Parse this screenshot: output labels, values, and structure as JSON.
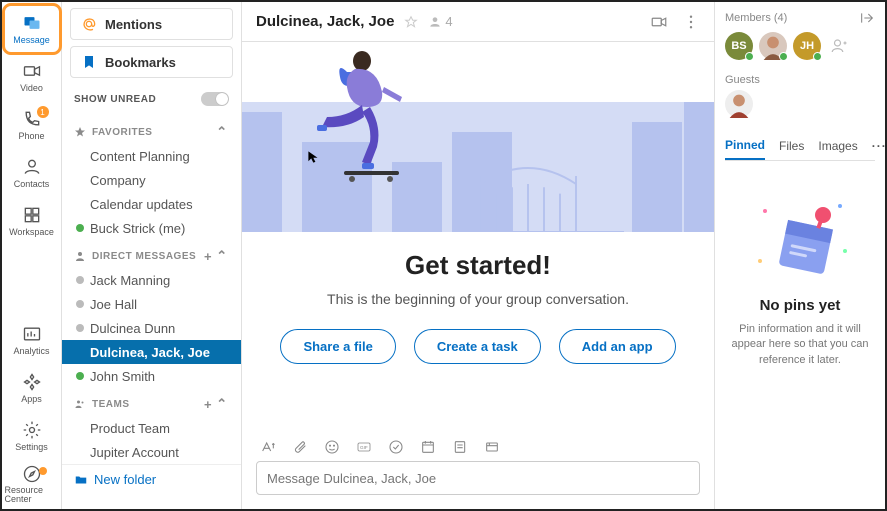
{
  "rail": {
    "items": [
      {
        "label": "Message",
        "active": true
      },
      {
        "label": "Video"
      },
      {
        "label": "Phone",
        "badge": "1"
      },
      {
        "label": "Contacts"
      },
      {
        "label": "Workspace"
      }
    ],
    "bottom": [
      {
        "label": "Analytics"
      },
      {
        "label": "Apps"
      },
      {
        "label": "Settings"
      },
      {
        "label": "Resource Center",
        "dot": true
      }
    ]
  },
  "sidebar": {
    "tabs": [
      {
        "label": "Mentions"
      },
      {
        "label": "Bookmarks"
      }
    ],
    "show_unread": "SHOW UNREAD",
    "sections": {
      "favorites": {
        "title": "FAVORITES",
        "items": [
          "Content Planning",
          "Company",
          "Calendar updates",
          "Buck Strick (me)"
        ]
      },
      "direct": {
        "title": "DIRECT MESSAGES",
        "items": [
          "Jack Manning",
          "Joe Hall",
          "Dulcinea Dunn",
          "Dulcinea, Jack, Joe",
          "John Smith"
        ]
      },
      "teams": {
        "title": "TEAMS",
        "items": [
          "Product Team",
          "Jupiter Account"
        ]
      }
    },
    "new_folder": "New folder"
  },
  "conversation": {
    "title": "Dulcinea, Jack, Joe",
    "member_count": "4",
    "get_started": "Get started!",
    "subtitle": "This is the beginning of your group conversation.",
    "actions": [
      "Share a file",
      "Create a task",
      "Add an app"
    ],
    "composer_placeholder": "Message Dulcinea, Jack, Joe"
  },
  "members": {
    "title": "Members (4)",
    "avatars": [
      {
        "initials": "BS",
        "bg": "#7a8a3a"
      },
      {
        "photo": true,
        "bg": "#d9c8bd"
      },
      {
        "initials": "JH",
        "bg": "#c49a2a"
      }
    ],
    "guests_label": "Guests",
    "tabs": [
      "Pinned",
      "Files",
      "Images"
    ],
    "pins_title": "No pins yet",
    "pins_text": "Pin information and it will appear here so that you can reference it later."
  }
}
